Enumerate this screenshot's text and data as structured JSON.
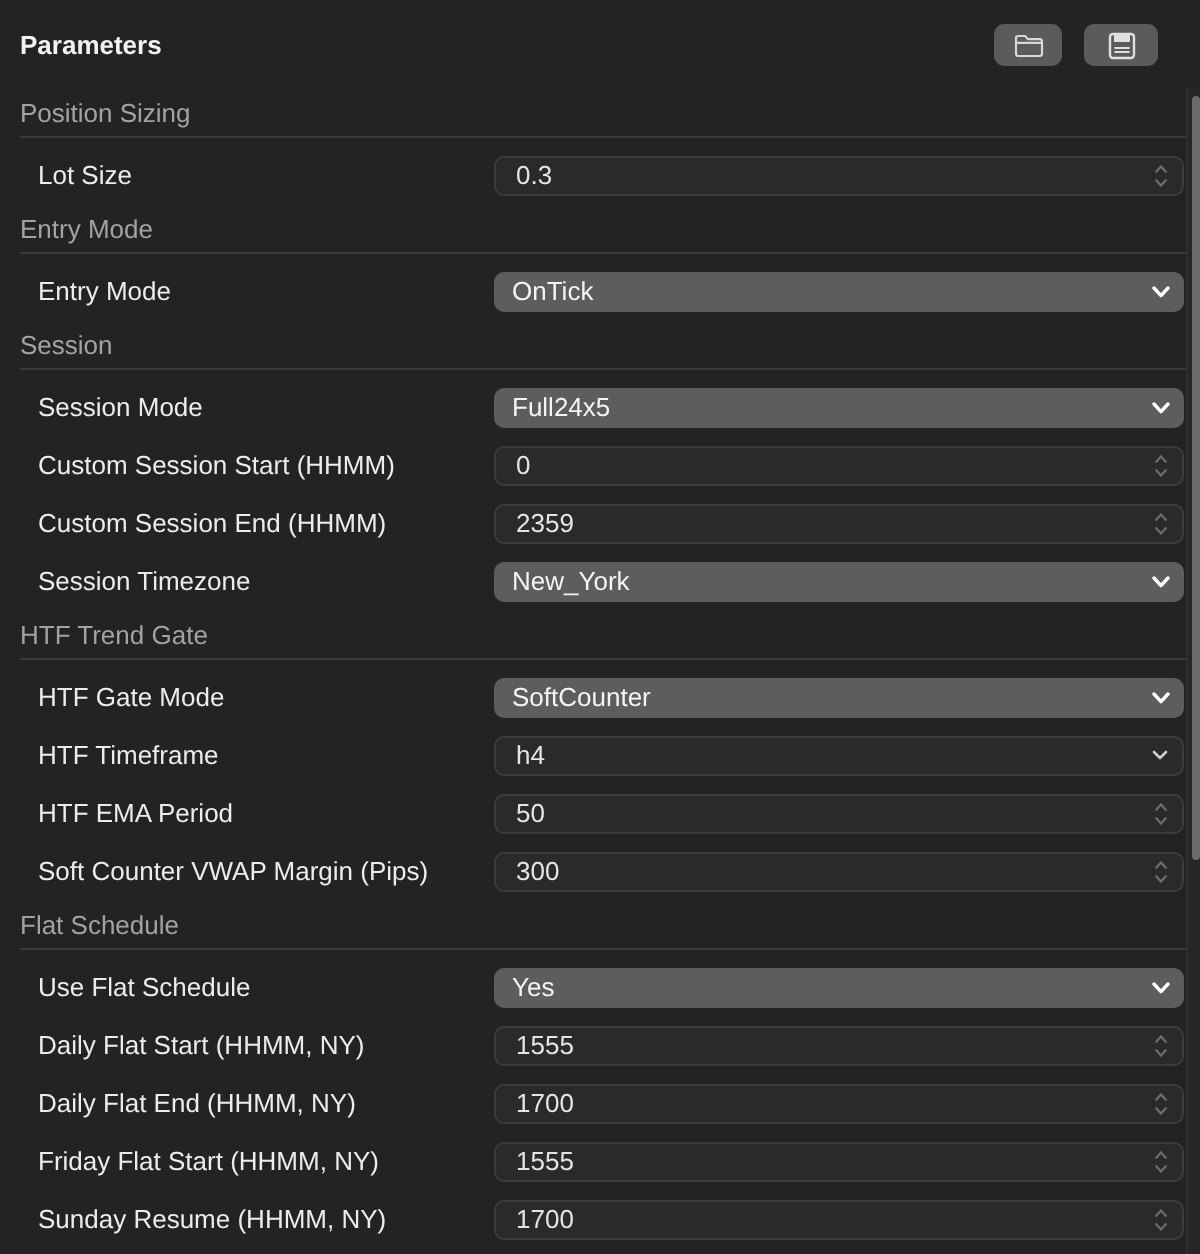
{
  "panel": {
    "title": "Parameters"
  },
  "sections": [
    {
      "title": "Position Sizing",
      "rows": [
        {
          "label": "Lot Size",
          "kind": "stepper",
          "value": "0.3"
        }
      ]
    },
    {
      "title": "Entry Mode",
      "rows": [
        {
          "label": "Entry Mode",
          "kind": "popup",
          "value": "OnTick"
        }
      ]
    },
    {
      "title": "Session",
      "rows": [
        {
          "label": "Session Mode",
          "kind": "popup",
          "value": "Full24x5"
        },
        {
          "label": "Custom Session Start (HHMM)",
          "kind": "stepper",
          "value": "0"
        },
        {
          "label": "Custom Session End (HHMM)",
          "kind": "stepper",
          "value": "2359"
        },
        {
          "label": "Session Timezone",
          "kind": "popup",
          "value": "New_York"
        }
      ]
    },
    {
      "title": "HTF Trend Gate",
      "rows": [
        {
          "label": "HTF Gate Mode",
          "kind": "popup",
          "value": "SoftCounter"
        },
        {
          "label": "HTF Timeframe",
          "kind": "combo",
          "value": "h4"
        },
        {
          "label": "HTF EMA Period",
          "kind": "stepper",
          "value": "50"
        },
        {
          "label": "Soft Counter VWAP Margin (Pips)",
          "kind": "stepper",
          "value": "300"
        }
      ]
    },
    {
      "title": "Flat Schedule",
      "rows": [
        {
          "label": "Use Flat Schedule",
          "kind": "popup",
          "value": "Yes"
        },
        {
          "label": "Daily Flat Start (HHMM, NY)",
          "kind": "stepper",
          "value": "1555"
        },
        {
          "label": "Daily Flat End (HHMM, NY)",
          "kind": "stepper",
          "value": "1700"
        },
        {
          "label": "Friday Flat Start (HHMM, NY)",
          "kind": "stepper",
          "value": "1555"
        },
        {
          "label": "Sunday Resume (HHMM, NY)",
          "kind": "stepper",
          "value": "1700"
        }
      ]
    }
  ]
}
